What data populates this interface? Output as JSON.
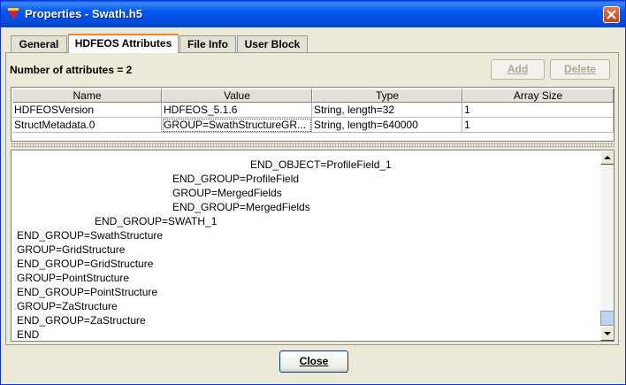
{
  "window": {
    "title": "Properties - Swath.h5"
  },
  "tabs": [
    {
      "label": "General",
      "active": false
    },
    {
      "label": "HDFEOS Attributes",
      "active": true
    },
    {
      "label": "File Info",
      "active": false
    },
    {
      "label": "User Block",
      "active": false
    }
  ],
  "attributes": {
    "count_label": "Number of attributes = 2",
    "add_label": "Add",
    "delete_label": "Delete",
    "columns": [
      "Name",
      "Value",
      "Type",
      "Array Size"
    ],
    "rows": [
      [
        "HDFEOSVersion",
        "HDFEOS_5.1.6",
        "String, length=32",
        "1"
      ],
      [
        "StructMetadata.0",
        "GROUP=SwathStructureGR...",
        "String, length=640000",
        "1"
      ]
    ]
  },
  "metadata_lines": [
    "END_OBJECT=ProfileField_1",
    "END_GROUP=ProfileField",
    "GROUP=MergedFields",
    "END_GROUP=MergedFields",
    "END_GROUP=SWATH_1",
    "END_GROUP=SwathStructure",
    "GROUP=GridStructure",
    "END_GROUP=GridStructure",
    "GROUP=PointStructure",
    "END_GROUP=PointStructure",
    "GROUP=ZaStructure",
    "END_GROUP=ZaStructure",
    "END"
  ],
  "footer": {
    "close_label": "Close"
  },
  "colors": {
    "titlebar": "#0058ee",
    "tab_highlight": "#e68b2c",
    "close_icon_bg": "#c4401e"
  },
  "icons": {
    "app": "app-icon",
    "window_close": "close-icon"
  }
}
